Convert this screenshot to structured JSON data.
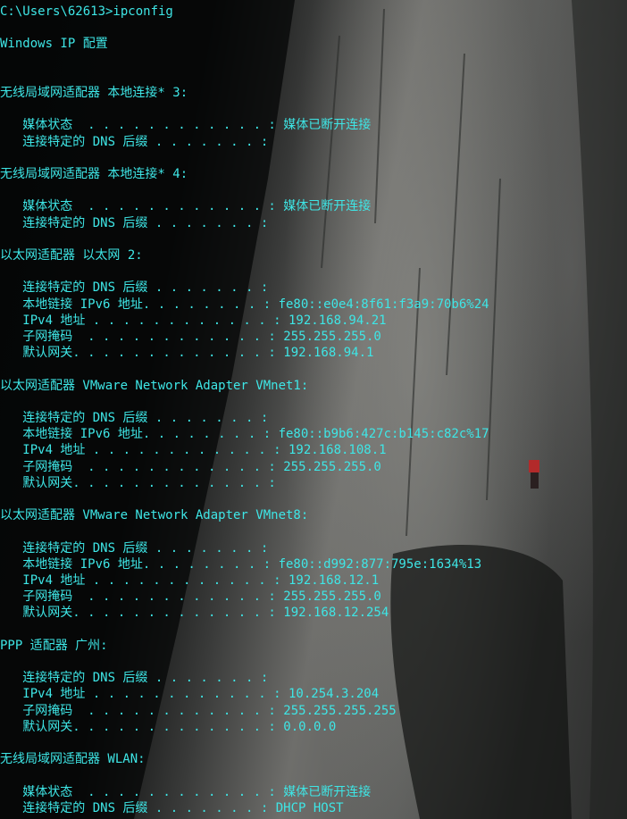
{
  "terminal": {
    "text_color": "#3ee6e6",
    "lines": [
      {
        "text": "C:\\Users\\62613>ipconfig",
        "row": 0
      },
      {
        "text": "Windows IP 配置",
        "row": 2
      },
      {
        "text": "无线局域网适配器 本地连接* 3:",
        "row": 5
      },
      {
        "text": "   媒体状态  . . . . . . . . . . . . : 媒体已断开连接",
        "row": 7
      },
      {
        "text": "   连接特定的 DNS 后缀 . . . . . . . :",
        "row": 8
      },
      {
        "text": "无线局域网适配器 本地连接* 4:",
        "row": 10
      },
      {
        "text": "   媒体状态  . . . . . . . . . . . . : 媒体已断开连接",
        "row": 12
      },
      {
        "text": "   连接特定的 DNS 后缀 . . . . . . . :",
        "row": 13
      },
      {
        "text": "以太网适配器 以太网 2:",
        "row": 15
      },
      {
        "text": "   连接特定的 DNS 后缀 . . . . . . . :",
        "row": 17
      },
      {
        "text": "   本地链接 IPv6 地址. . . . . . . . : fe80::e0e4:8f61:f3a9:70b6%24",
        "row": 18
      },
      {
        "text": "   IPv4 地址 . . . . . . . . . . . . : 192.168.94.21",
        "row": 19
      },
      {
        "text": "   子网掩码  . . . . . . . . . . . . : 255.255.255.0",
        "row": 20
      },
      {
        "text": "   默认网关. . . . . . . . . . . . . : 192.168.94.1",
        "row": 21
      },
      {
        "text": "以太网适配器 VMware Network Adapter VMnet1:",
        "row": 23
      },
      {
        "text": "   连接特定的 DNS 后缀 . . . . . . . :",
        "row": 25
      },
      {
        "text": "   本地链接 IPv6 地址. . . . . . . . : fe80::b9b6:427c:b145:c82c%17",
        "row": 26
      },
      {
        "text": "   IPv4 地址 . . . . . . . . . . . . : 192.168.108.1",
        "row": 27
      },
      {
        "text": "   子网掩码  . . . . . . . . . . . . : 255.255.255.0",
        "row": 28
      },
      {
        "text": "   默认网关. . . . . . . . . . . . . :",
        "row": 29
      },
      {
        "text": "以太网适配器 VMware Network Adapter VMnet8:",
        "row": 31
      },
      {
        "text": "   连接特定的 DNS 后缀 . . . . . . . :",
        "row": 33
      },
      {
        "text": "   本地链接 IPv6 地址. . . . . . . . : fe80::d992:877:795e:1634%13",
        "row": 34
      },
      {
        "text": "   IPv4 地址 . . . . . . . . . . . . : 192.168.12.1",
        "row": 35
      },
      {
        "text": "   子网掩码  . . . . . . . . . . . . : 255.255.255.0",
        "row": 36
      },
      {
        "text": "   默认网关. . . . . . . . . . . . . : 192.168.12.254",
        "row": 37
      },
      {
        "text": "PPP 适配器 广州:",
        "row": 39
      },
      {
        "text": "   连接特定的 DNS 后缀 . . . . . . . :",
        "row": 41
      },
      {
        "text": "   IPv4 地址 . . . . . . . . . . . . : 10.254.3.204",
        "row": 42
      },
      {
        "text": "   子网掩码  . . . . . . . . . . . . : 255.255.255.255",
        "row": 43
      },
      {
        "text": "   默认网关. . . . . . . . . . . . . : 0.0.0.0",
        "row": 44
      },
      {
        "text": "无线局域网适配器 WLAN:",
        "row": 46
      },
      {
        "text": "   媒体状态  . . . . . . . . . . . . : 媒体已断开连接",
        "row": 48
      },
      {
        "text": "   连接特定的 DNS 后缀 . . . . . . . : DHCP HOST",
        "row": 49
      }
    ]
  }
}
